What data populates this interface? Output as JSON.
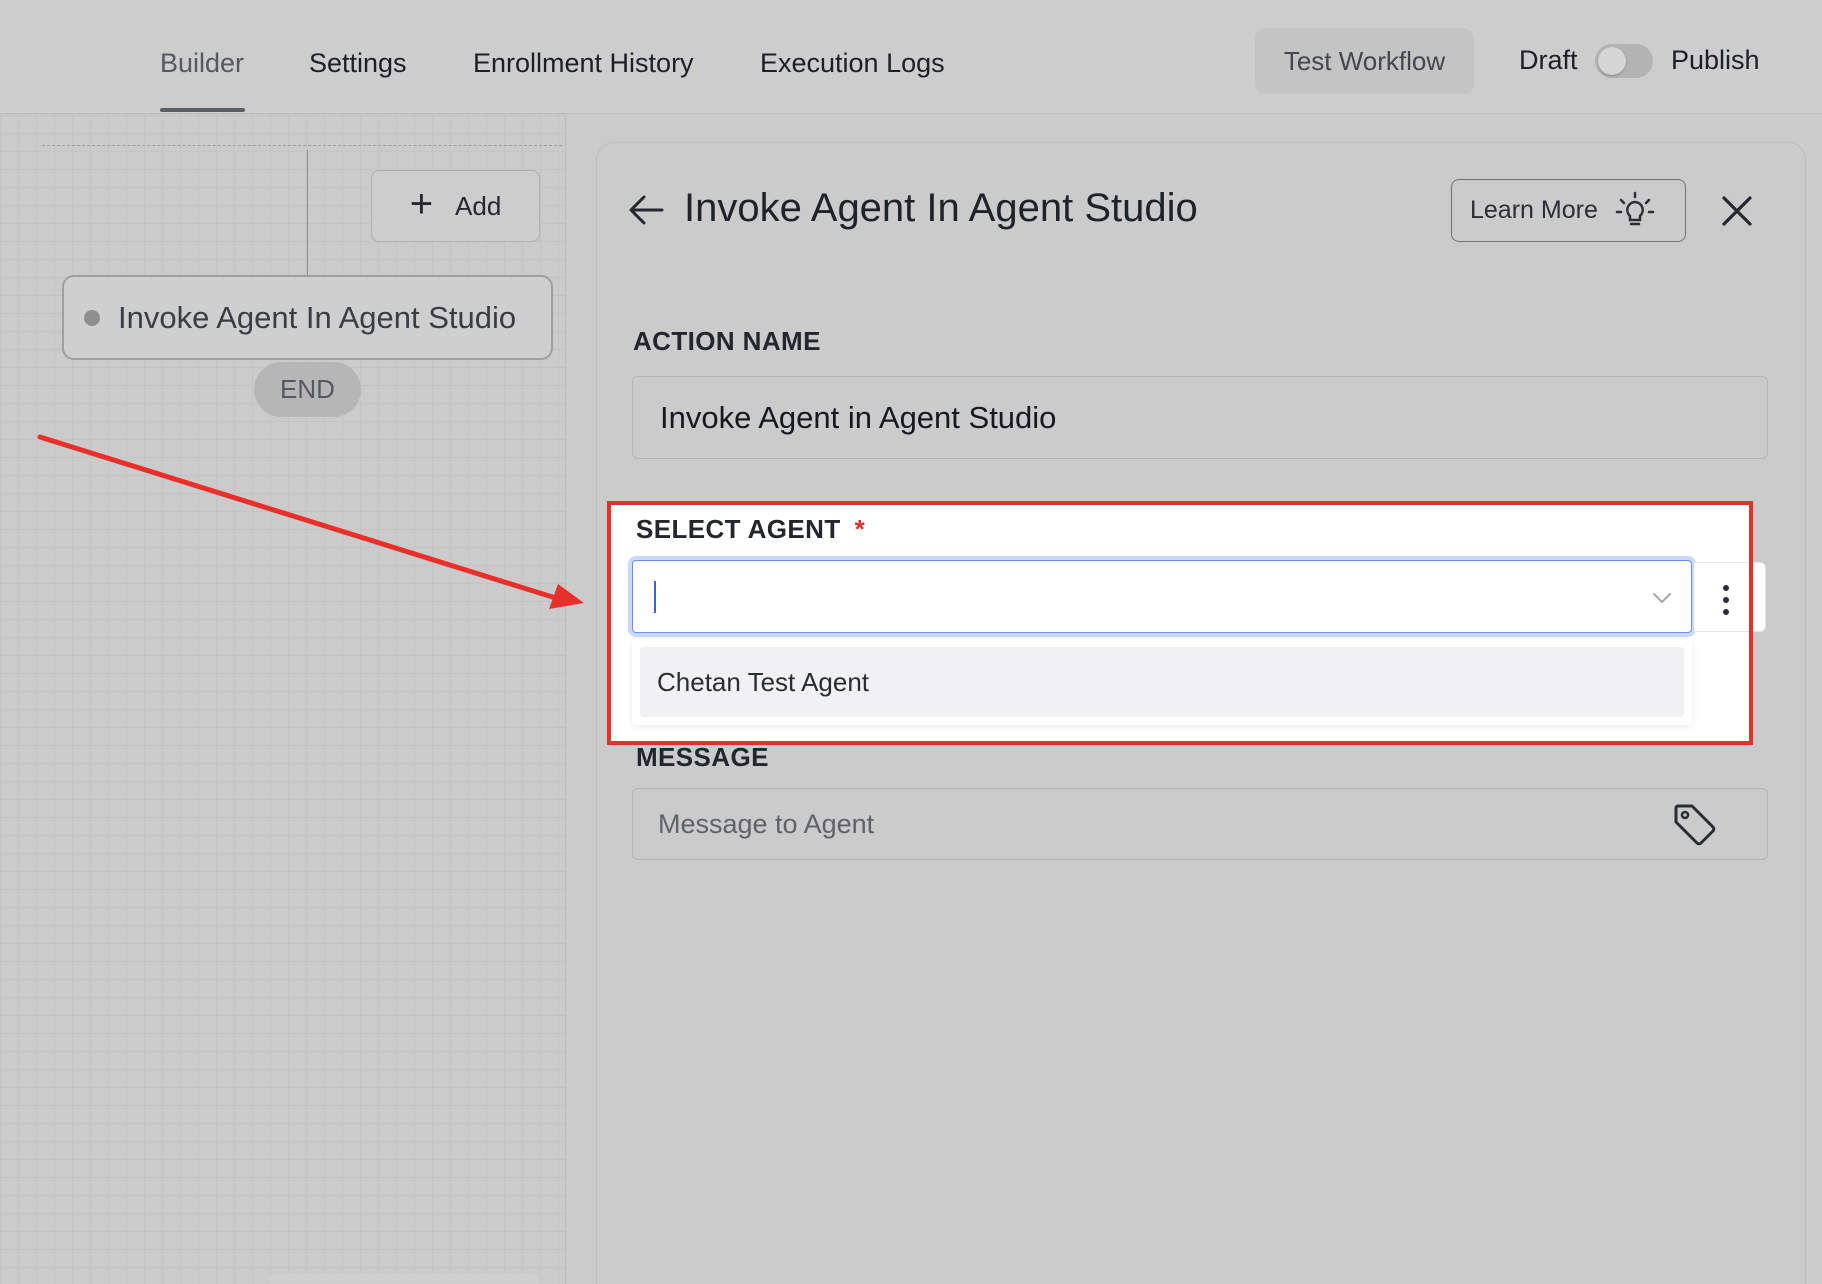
{
  "nav": {
    "tabs": [
      {
        "label": "Builder",
        "active": true
      },
      {
        "label": "Settings",
        "active": false
      },
      {
        "label": "Enrollment History",
        "active": false
      },
      {
        "label": "Execution Logs",
        "active": false
      }
    ],
    "test_workflow_label": "Test Workflow",
    "draft_label": "Draft",
    "publish_label": "Publish",
    "publish_toggle_on": false
  },
  "canvas": {
    "add_label": "Add",
    "node_label": "Invoke Agent In Agent Studio",
    "end_label": "END"
  },
  "panel": {
    "title": "Invoke Agent In Agent Studio",
    "learn_more_label": "Learn More",
    "action_name": {
      "label": "ACTION NAME",
      "value": "Invoke Agent in Agent Studio"
    },
    "select_agent": {
      "label": "SELECT AGENT",
      "required_mark": "*",
      "value": "",
      "options": [
        "Chetan Test Agent"
      ]
    },
    "message": {
      "label": "MESSAGE",
      "placeholder": "Message to Agent"
    }
  },
  "colors": {
    "annotation_red": "#e8302a",
    "focus_blue": "#6b8ee8",
    "required_red": "#d9302c"
  },
  "icons": [
    "plus-icon",
    "back-arrow-icon",
    "lightbulb-icon",
    "close-icon",
    "chevron-down-icon",
    "kebab-menu-icon",
    "tag-icon"
  ]
}
